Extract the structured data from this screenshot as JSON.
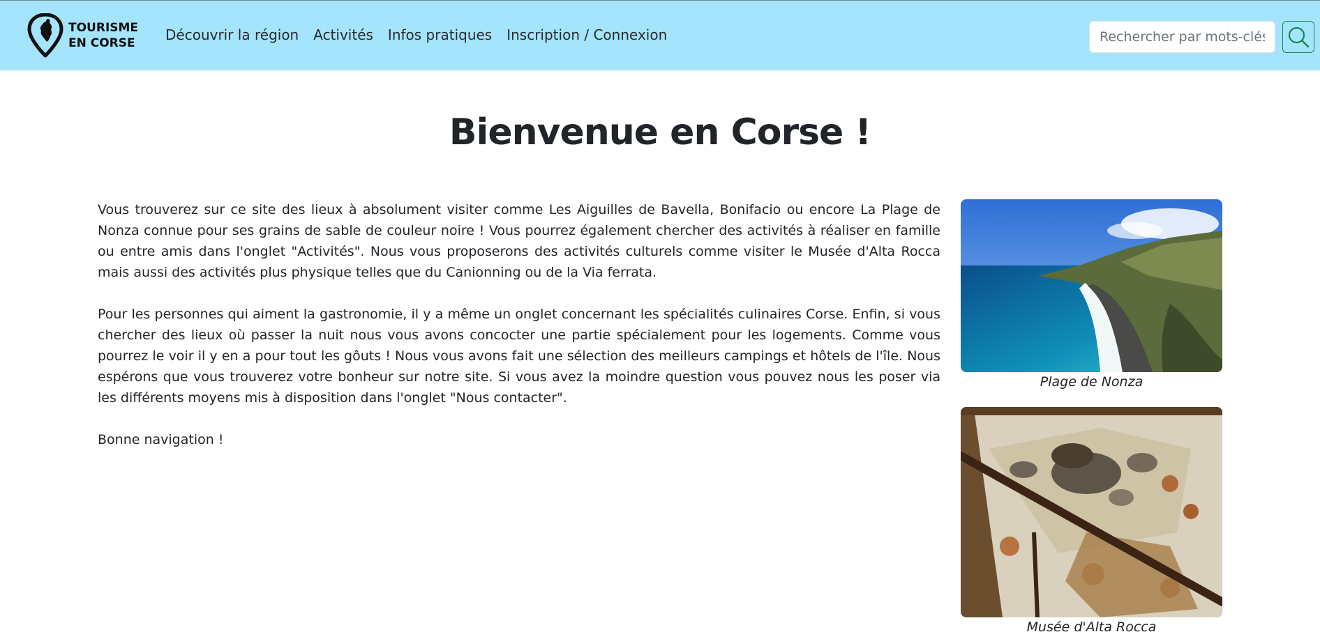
{
  "navbar": {
    "brand": {
      "line1": "TOURISME",
      "line2": "EN CORSE"
    },
    "links": [
      {
        "label": "Découvrir la région"
      },
      {
        "label": "Activités"
      },
      {
        "label": "Infos pratiques"
      },
      {
        "label": "Inscription / Connexion"
      }
    ],
    "search": {
      "placeholder": "Rechercher par mots-clés",
      "button_icon": "search-icon"
    }
  },
  "main": {
    "title": "Bienvenue en Corse !",
    "paragraphs": [
      "Vous trouverez sur ce site des lieux à absolument visiter comme Les Aiguilles de Bavella, Bonifacio ou encore La Plage de Nonza connue pour ses grains de sable de couleur noire ! Vous pourrez également chercher des activités à réaliser en famille ou entre amis dans l'onglet \"Activités\". Nous vous proposerons des activités culturels comme visiter le Musée d'Alta Rocca mais aussi des activités plus physique telles que du Canionning ou de la Via ferrata.",
      "Pour les personnes qui aiment la gastronomie, il y a même un onglet concernant les spécialités culinaires Corse. Enfin, si vous chercher des lieux où passer la nuit nous vous avons concocter une partie spécialement pour les logements. Comme vous pourrez le voir il y en a pour tout les gôuts ! Nous vous avons fait une sélection des meilleurs campings et hôtels de l'île. Nous espérons que vous trouverez votre bonheur sur notre site. Si vous avez la moindre question vous pouvez nous les poser via les différents moyens mis à disposition dans l'onglet \"Nous contacter\".",
      "Bonne navigation !"
    ],
    "gallery": [
      {
        "caption": "Plage de Nonza"
      },
      {
        "caption": "Musée d'Alta Rocca"
      }
    ]
  },
  "colors": {
    "navbar_bg": "#a4e4fc",
    "search_button_border": "#198754",
    "text": "#212529"
  }
}
